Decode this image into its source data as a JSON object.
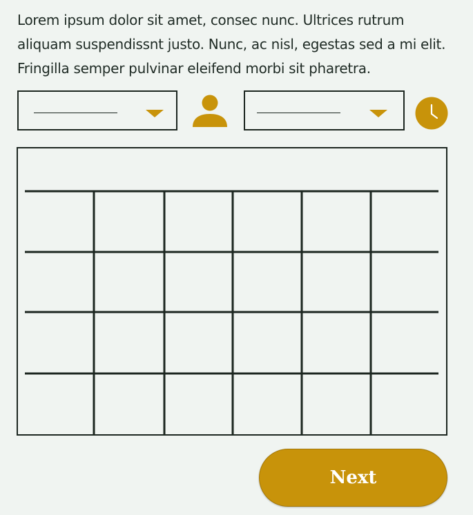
{
  "intro_text": "Lorem ipsum dolor sit amet, consec nunc. Ultrices rutrum aliquam suspendissnt justo. Nunc, ac nisl, egestas sed a mi elit. Fringilla semper pulvinar eleifend morbi sit pharetra.",
  "left_select": {
    "value": "",
    "icon": "chevron-down-icon"
  },
  "right_select": {
    "value": "",
    "icon": "chevron-down-icon"
  },
  "icons": {
    "person": "person-icon",
    "clock": "clock-icon"
  },
  "calendar_grid": {
    "columns": 6,
    "rows": 4
  },
  "next_button": {
    "label": "Next"
  },
  "colors": {
    "accent": "#c8930a",
    "background": "#f0f4f1",
    "ink": "#1c2620",
    "button_text": "#ffffff"
  }
}
